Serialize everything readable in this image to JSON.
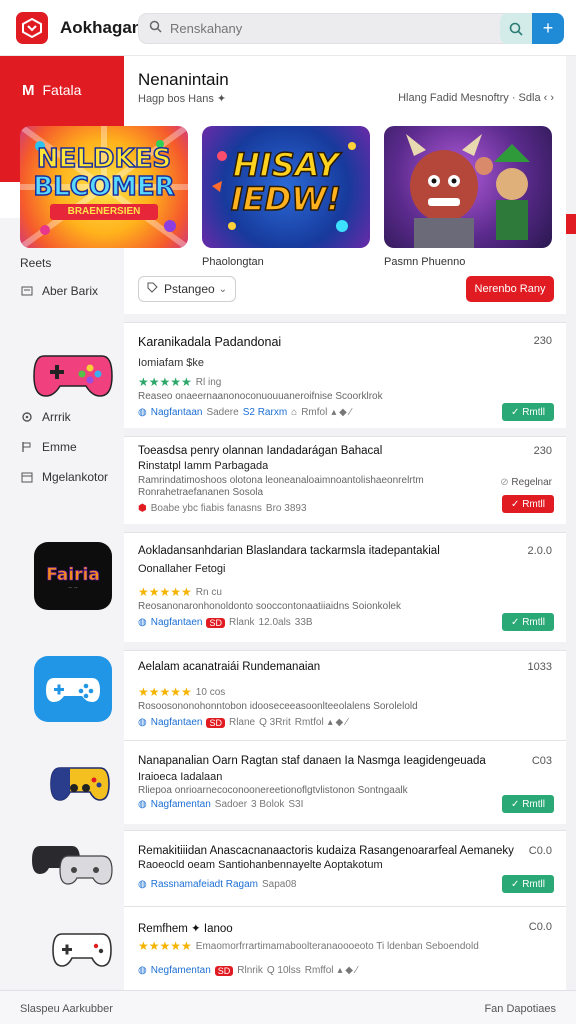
{
  "header": {
    "app_title": "Aokhagan",
    "search_placeholder": "Renskahany",
    "add_label": "+"
  },
  "sidebar": {
    "active_label": "Fatala",
    "items": [
      {
        "label": "Reets",
        "icon": "none"
      },
      {
        "label": "Aber Barix",
        "icon": "tag-icon"
      },
      {
        "label": "Arrrik",
        "icon": "gear-icon"
      },
      {
        "label": "Emme",
        "icon": "flag-icon"
      },
      {
        "label": "Mgelankotor",
        "icon": "calendar-icon"
      }
    ]
  },
  "featured": {
    "title": "Nenanintain",
    "subtitle": "Hagp bos Hans ✦",
    "right_text": "Hlang Fadid Mesnoftry · Sdla ‹ ›",
    "banners": [
      {
        "title_line1": "NELDKES",
        "title_line2": "BLCOMER",
        "title_line3": "BRAENERSIEN",
        "caption": ""
      },
      {
        "title_line1": "HISAY",
        "title_line2": "IEDW!",
        "caption": "Phaolongtan"
      },
      {
        "title_line1": "",
        "title_line2": "",
        "caption": "Pasmn Phuenno"
      }
    ],
    "dropdown_label": "Pstangeo",
    "cta_label": "Nerenbo Rany"
  },
  "games": [
    {
      "title": "Karanikadala Padandonai",
      "line2": "Iomiafam $ke",
      "rating_text": "Rl ing",
      "desc": "Reaseo onaeernaanonoconuouuaneroifnise Scoorklrok",
      "meta": [
        "Nagfantaan",
        "Sadere",
        "S2 Rarxm",
        "Rmfol"
      ],
      "price": "230",
      "action": "Rmtll",
      "action_color": "green"
    },
    {
      "title": "Toeasdsa penry olannan Iandadarágan Bahacal",
      "line2": "Rinstatpl Iamm Parbagada",
      "desc": "Ramrindatimoshoos olotona leoneanaloaimnoantolishaeonrelrtm",
      "desc2": "Ronrahetraefananen Sosola",
      "meta": [
        "Boabe ybc fiabis fanasns",
        "Bro 3893"
      ],
      "price": "230",
      "tag": "Regelnar",
      "action": "Rmtll",
      "action_color": "red"
    },
    {
      "title": "Aokladansanhdarian Blaslandara tackarmsla itadepantakial",
      "line2": "Oonallaher Fetogi",
      "rating_text": "Rn cu",
      "desc": "Reosanonaronhonoldonto sooccontonaatiiaidns Soionkolek",
      "meta": [
        "Nagfantaen",
        "Rlank",
        "12.0als",
        "33B"
      ],
      "price": "2.0.0",
      "action": "Rmtll",
      "action_color": "green"
    },
    {
      "title": "Aelalam acanatraiái Rundemanaian",
      "rating_text": "10 cos",
      "desc": "Rosoosononohonntobon idooseceeasoonlteeolalens Sorolelold",
      "meta": [
        "Nagfantaen",
        "Rlane",
        "Q 3Rrit",
        "Rmtfol"
      ],
      "price": "1033",
      "action": "",
      "action_color": ""
    },
    {
      "title": "Nanapanalian Oarn Ragtan staf danaen Ia Nasmga Ieagidengeuada",
      "line2": "Iraioeca Iadalaan",
      "desc": "Rliepoa onrioarnecoconoonereetionoflgtvlistonon Sontngaalk",
      "meta": [
        "Nagfamentan",
        "Sadoer",
        "3 Bolok",
        "S3I"
      ],
      "price": "C03",
      "action": "Rmtll",
      "action_color": "green"
    },
    {
      "title": "Remakitiiidan Anascacnanaactoris kudaiza Rasangenoararfeal Aemaneky",
      "line2": "Raoeocld oeam Santiohanbennayelte Aoptakotum",
      "meta": [
        "Rassnamafeiadt Ragam",
        "Sapa08"
      ],
      "price": "C0.0",
      "action": "Rmtll",
      "action_color": "green"
    },
    {
      "title": "Remfhem ✦ Ianoo",
      "desc": "Emaomorfrrartimamaboolteranaoooeoto Ti ldenban Seboendold",
      "meta": [
        "Negfamentan",
        "Rlnrik",
        "Q 10lss",
        "Rmffol"
      ],
      "price": "C0.0",
      "action": "",
      "action_color": ""
    }
  ],
  "footer": {
    "left": "Slaspeu Aarkubber",
    "right": "Fan   Dapotiaes"
  },
  "colors": {
    "brand_red": "#e11b22",
    "action_green": "#2aa876",
    "link_blue": "#1c6fd4",
    "accent_blue": "#1f8bd6"
  }
}
